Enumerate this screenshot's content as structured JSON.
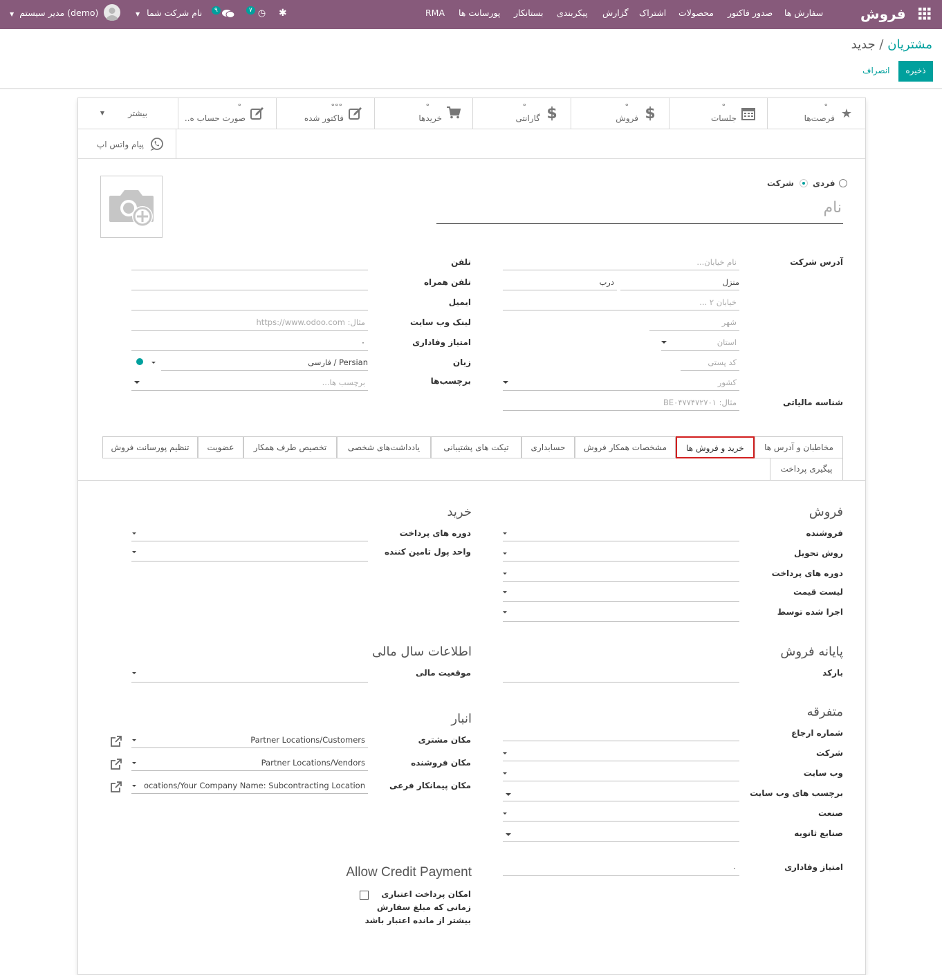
{
  "navbar": {
    "brand": "فروش",
    "menu": [
      "سفارش ها",
      "صدور فاکتور",
      "محصولات",
      "اشتراک",
      "گزارش",
      "پیکربندی",
      "بستانکار",
      "پورسانت ها",
      "RMA"
    ],
    "activity_count": "۷",
    "chat_count": "۹",
    "company": "نام شرکت شما",
    "user": "مدیر سیستم (demo)"
  },
  "breadcrumb": {
    "parent": "مشتریان",
    "separator": "/",
    "current": "جدید"
  },
  "actions": {
    "save": "ذخیره",
    "discard": "انصراف"
  },
  "smart_buttons": {
    "opportunities": "فرصت‌ها",
    "meetings": "جلسات",
    "sales": "فروش",
    "warranty": "گارانتی",
    "purchases": "خریدها",
    "invoiced": "فاکتور شده",
    "statement": "صورت حساب ه..",
    "more": "بیشتر",
    "whatsapp": "پیام واتس اپ",
    "dot": "°",
    "dots": "°°°"
  },
  "partner_type": {
    "individual": "فردی",
    "company": "شرکت",
    "selected": "company"
  },
  "name_placeholder": "نام",
  "address": {
    "label": "آدرس شرکت",
    "street_ph": "نام خیابان...",
    "home": "منزل",
    "door": "درب",
    "street2_ph": "خیابان ۲ ...",
    "city_ph": "شهر",
    "state_ph": "استان",
    "zip_ph": "کد پستی",
    "country_ph": "کشور"
  },
  "vat": {
    "label": "شناسه مالیاتی",
    "placeholder": "مثال: BE۰۴۷۷۴۷۲۷۰۱"
  },
  "contact": {
    "phone": "تلفن",
    "mobile": "تلفن همراه",
    "email": "ایمیل",
    "website": "لینک وب سایت",
    "website_ph": "مثال: https://www.odoo.com",
    "loyalty": "امتیاز وفاداری",
    "loyalty_value": "۰",
    "language": "زبان",
    "language_value": "Persian / فارسی",
    "tags": "برچسب‌ها",
    "tags_ph": "برچسب ها..."
  },
  "tabs": [
    "مخاطبان و آدرس ها",
    "خرید و فروش ها",
    "مشخصات همکار فروش",
    "حسابداری",
    "تیکت های پشتیبانی",
    "یادداشت‌های شخصی",
    "تخصیص طرف همکار",
    "عضویت",
    "تنظیم پورسانت فروش",
    "پیگیری پرداخت"
  ],
  "active_tab": "خرید و فروش ها",
  "sales_section": {
    "title": "فروش",
    "fields": [
      "فروشنده",
      "روش تحویل",
      "دوره های پرداخت",
      "لیست قیمت",
      "اجرا شده توسط"
    ]
  },
  "purchase_section": {
    "title": "خرید",
    "fields": [
      "دوره های پرداخت",
      "واحد پول تامین کننده"
    ]
  },
  "pos_section": {
    "title": "پایانه فروش",
    "barcode": "بارکد"
  },
  "fiscal_section": {
    "title": "اطلاعات سال مالی",
    "fiscal_position": "موقعیت مالی"
  },
  "misc_section": {
    "title": "متفرقه",
    "fields": [
      "شماره ارجاع",
      "شرکت",
      "وب سایت",
      "برچسب های وب سایت",
      "صنعت",
      "صنایع ثانویه"
    ],
    "loyalty": "امتیاز وفاداری",
    "loyalty_value": "۰"
  },
  "warehouse_section": {
    "title": "انبار",
    "customer_loc": "مکان مشتری",
    "customer_loc_value": "Partner Locations/Customers",
    "vendor_loc": "مکان فروشنده",
    "vendor_loc_value": "Partner Locations/Vendors",
    "sub_loc": "مکان پیمانکار فرعی",
    "sub_loc_value": "ocations/Your Company Name: Subcontracting Location"
  },
  "credit_section": {
    "title": "Allow Credit Payment",
    "label_line1": "امکان پرداخت اعتباری",
    "label_line2": "زمانی که مبلغ سفارش",
    "label_line3": "بیشتر از مانده اعتبار باشد"
  }
}
